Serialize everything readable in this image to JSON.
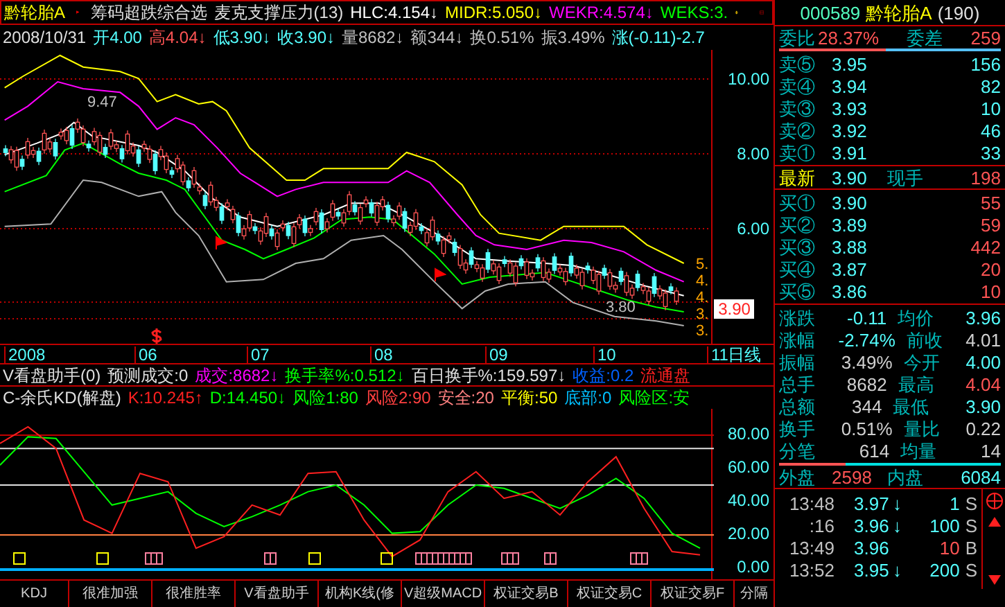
{
  "header": {
    "line_1": [
      {
        "text": "黔轮胎A",
        "color": "#ffff00"
      },
      {
        "text": "筹码超跌综合选",
        "color": "#e0e0e0"
      },
      {
        "text": "麦克支撑压力(13)",
        "color": "#e0e0e0"
      },
      {
        "text": "HLC:4.154↓",
        "color": "#ffffff"
      },
      {
        "text": "MIDR:5.050↓",
        "color": "#ffff00"
      },
      {
        "text": "WEKR:4.574↓",
        "color": "#ff00ff"
      },
      {
        "text": "WEKS:3.",
        "color": "#00ff00"
      }
    ],
    "line_2": [
      {
        "text": "2008/10/31",
        "color": "#e0e0e0"
      },
      {
        "text": "开4.00",
        "color": "#54ffff"
      },
      {
        "text": "高4.04↓",
        "color": "#ff5454"
      },
      {
        "text": "低3.90↓",
        "color": "#54ffff"
      },
      {
        "text": "收3.90↓",
        "color": "#54ffff"
      },
      {
        "text": "量8682↓",
        "color": "#c0c0c0"
      },
      {
        "text": "额344↓",
        "color": "#c0c0c0"
      },
      {
        "text": "换0.51%",
        "color": "#c0c0c0"
      },
      {
        "text": "振3.49%",
        "color": "#c0c0c0"
      },
      {
        "text": "涨(-0.11)-2.7",
        "color": "#54ffff"
      }
    ]
  },
  "main_chart": {
    "y_labels": [
      "10.00",
      "8.00",
      "6.00"
    ],
    "price_tag": "3.90",
    "high_label": "9.47",
    "low_label": "3.80",
    "end_labels": [
      "5.",
      "4.",
      "4.",
      "3.",
      "3."
    ],
    "x_labels": [
      "2008",
      "06",
      "07",
      "08",
      "09",
      "10",
      "11"
    ],
    "period": "日线"
  },
  "indicator_lines": [
    [
      {
        "text": "V看盘助手(0)",
        "color": "#e0e0e0"
      },
      {
        "text": "预测成交:0",
        "color": "#e0e0e0"
      },
      {
        "text": "成交:8682↓",
        "color": "#ff00ff"
      },
      {
        "text": "换手率%:0.512↓",
        "color": "#00ff00"
      },
      {
        "text": "百日换手%:159.597↓",
        "color": "#e0e0e0"
      },
      {
        "text": "收益:0.2",
        "color": "#0060ff"
      },
      {
        "text": "流通盘",
        "color": "#ff2020"
      }
    ],
    [
      {
        "text": "C-余氏KD(解盘)",
        "color": "#e0e0e0"
      },
      {
        "text": "K:10.245↑",
        "color": "#ff2020"
      },
      {
        "text": "D:14.450↓",
        "color": "#00ff00"
      },
      {
        "text": "风险1:80",
        "color": "#00ff00"
      },
      {
        "text": "风险2:90",
        "color": "#ff4040"
      },
      {
        "text": "安全:20",
        "color": "#ff8080"
      },
      {
        "text": "平衡:50",
        "color": "#ffff00"
      },
      {
        "text": "底部:0",
        "color": "#00c0ff"
      },
      {
        "text": "风险区:安",
        "color": "#00ff00"
      }
    ]
  ],
  "lower_chart": {
    "chart_data": {
      "type": "line",
      "ylim": [
        0,
        95
      ],
      "ref_lines": [
        {
          "axis": "y",
          "value": 80,
          "color": "#c00000"
        },
        {
          "axis": "y",
          "value": 72,
          "color": "#e0e0e0"
        },
        {
          "axis": "y",
          "value": 50,
          "color": "#e0e0e0"
        },
        {
          "axis": "y",
          "value": 20,
          "color": "#ff8040"
        }
      ],
      "yticks": [
        {
          "value": 80,
          "label": "80.00"
        },
        {
          "value": 60,
          "label": "60.00"
        },
        {
          "value": 40,
          "label": "40.00"
        },
        {
          "value": 20,
          "label": "20.00"
        },
        {
          "value": 0,
          "label": "0.00"
        }
      ],
      "series": [
        {
          "color": "#ff2020",
          "values": [
            75,
            85,
            72,
            29,
            21,
            57,
            52,
            12,
            19,
            38,
            32,
            57,
            58,
            29,
            7,
            17,
            46,
            58,
            42,
            46,
            32,
            52,
            67,
            36,
            10,
            8
          ]
        },
        {
          "color": "#00ff00",
          "values": [
            62,
            79,
            78,
            58,
            38,
            42,
            46,
            33,
            25,
            31,
            38,
            46,
            50,
            38,
            21,
            22,
            38,
            50,
            48,
            42,
            36,
            44,
            54,
            42,
            21,
            12
          ]
        }
      ]
    }
  },
  "tabs": [
    {
      "label": "KDJ",
      "selected": false
    },
    {
      "label": "很准加强",
      "selected": false
    },
    {
      "label": "很准胜率",
      "selected": false
    },
    {
      "label": "V看盘助手",
      "selected": false
    },
    {
      "label": "机构K线(修",
      "selected": false
    },
    {
      "label": "V超级MACD",
      "selected": false
    },
    {
      "label": "权证交易B",
      "selected": false
    },
    {
      "label": "权证交易C",
      "selected": false
    },
    {
      "label": "权证交易F",
      "selected": false
    },
    {
      "label": "分隔",
      "selected": false
    }
  ],
  "quote_panel": {
    "code": "000589",
    "name": "黔轮胎A",
    "count": "(190)",
    "ratio_label": "委比",
    "ratio": "28.37%",
    "diff_label": "委差",
    "diff": "259",
    "ratio_bar": {
      "level": 0.48
    },
    "sells": [
      {
        "label": "卖⑤",
        "price": "3.95",
        "volume": "156"
      },
      {
        "label": "卖④",
        "price": "3.94",
        "volume": "82"
      },
      {
        "label": "卖③",
        "price": "3.93",
        "volume": "10"
      },
      {
        "label": "卖②",
        "price": "3.92",
        "volume": "46"
      },
      {
        "label": "卖①",
        "price": "3.91",
        "volume": "33"
      }
    ],
    "latest": {
      "label": "最新",
      "price": "3.90",
      "volume_label": "现手",
      "volume": "198"
    },
    "buys": [
      {
        "label": "买①",
        "price": "3.90",
        "volume": "55"
      },
      {
        "label": "买②",
        "price": "3.89",
        "volume": "59"
      },
      {
        "label": "买③",
        "price": "3.88",
        "volume": "442"
      },
      {
        "label": "买④",
        "price": "3.87",
        "volume": "20"
      },
      {
        "label": "买⑤",
        "price": "3.86",
        "volume": "10"
      }
    ],
    "stats": [
      {
        "label": "涨跌",
        "value": "-0.11",
        "color": "#54ffff"
      },
      {
        "label": "均价",
        "value": "3.96",
        "color": "#54ffff"
      },
      {
        "label": "涨幅",
        "value": "-2.74%",
        "color": "#54ffff"
      },
      {
        "label": "前收",
        "value": "4.01",
        "color": "#d0d0d0"
      },
      {
        "label": "振幅",
        "value": "3.49%",
        "color": "#d0d0d0"
      },
      {
        "label": "今开",
        "value": "4.00",
        "color": "#54ffff"
      },
      {
        "label": "总手",
        "value": "8682",
        "color": "#d0d0d0"
      },
      {
        "label": "最高",
        "value": "4.04",
        "color": "#ff5454"
      },
      {
        "label": "总额",
        "value": "344",
        "color": "#d0d0d0"
      },
      {
        "label": "最低",
        "value": "3.90",
        "color": "#54ffff"
      },
      {
        "label": "换手",
        "value": "0.51%",
        "color": "#d0d0d0"
      },
      {
        "label": "量比",
        "value": "0.22",
        "color": "#d0d0d0"
      },
      {
        "label": "分笔",
        "value": "614",
        "color": "#d0d0d0"
      },
      {
        "label": "均量",
        "value": "14",
        "color": "#d0d0d0"
      }
    ],
    "outer_label": "外盘",
    "outer": "2598",
    "inner_label": "内盘",
    "inner": "6084",
    "volume_bar": {
      "level": 0.3
    },
    "ticks": [
      {
        "time": "13:48",
        "price": "3.97",
        "arrow": "↓",
        "volume": "1",
        "color": "#54ffff",
        "side": "S"
      },
      {
        "time": ":16",
        "price": "3.96",
        "arrow": "↓",
        "volume": "100",
        "color": "#54ffff",
        "side": "S"
      },
      {
        "time": "13:49",
        "price": "3.96",
        "volume": "10",
        "color": "#ff5454",
        "side": "B"
      },
      {
        "time": "13:52",
        "price": "3.95",
        "arrow": "↓",
        "volume": "200",
        "color": "#54ffff",
        "side": "S"
      }
    ]
  }
}
